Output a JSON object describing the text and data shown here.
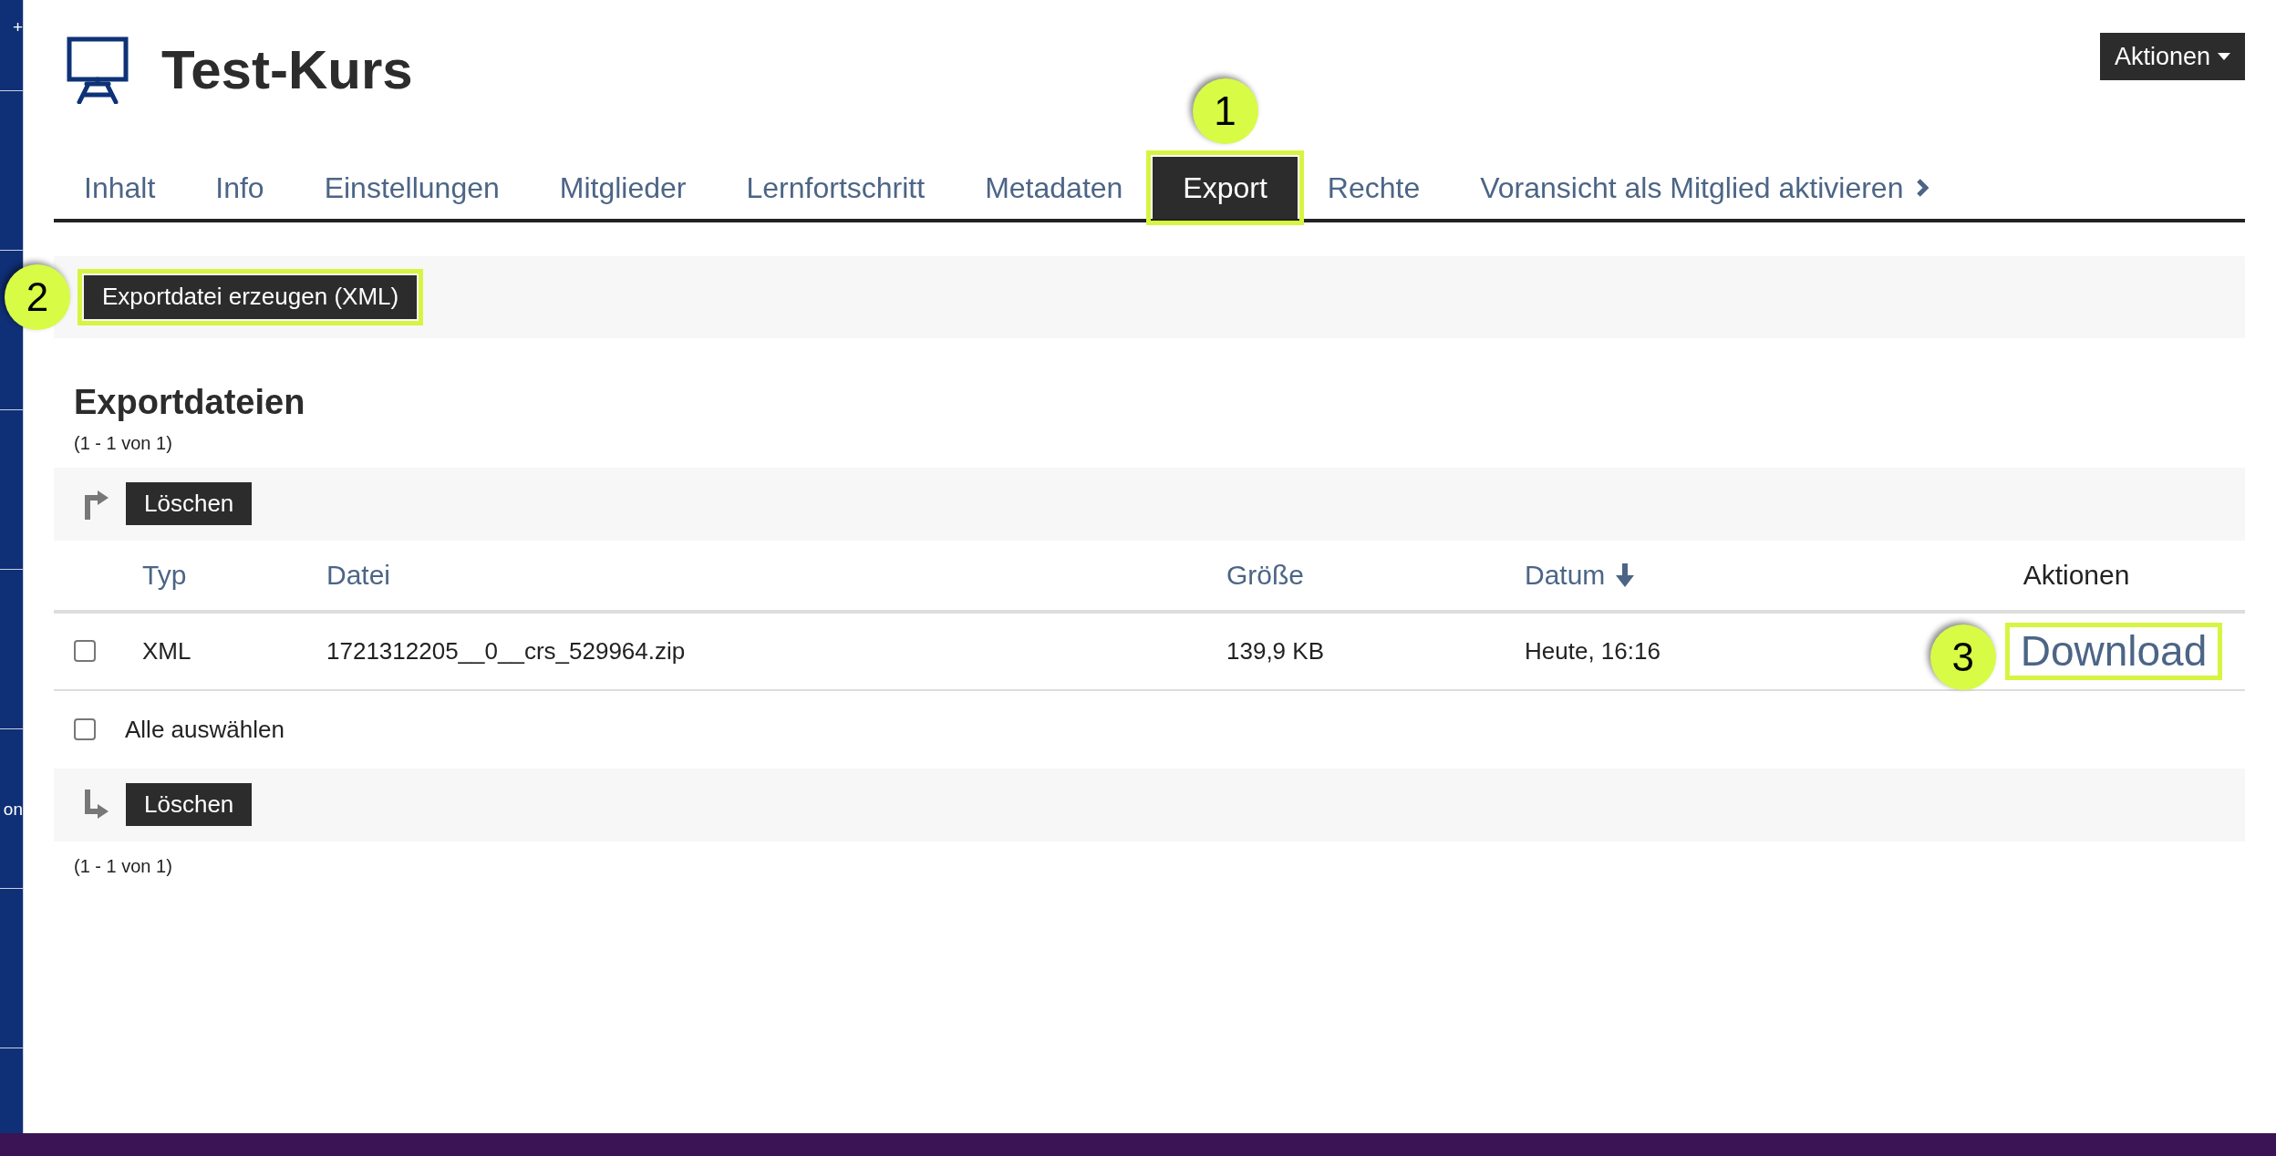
{
  "sidebar": {
    "items": [
      {
        "label": "+"
      },
      {
        "label": "on"
      }
    ]
  },
  "header": {
    "title": "Test-Kurs",
    "actions_button": "Aktionen"
  },
  "tabs": [
    {
      "label": "Inhalt",
      "selected": false,
      "kind": "tab"
    },
    {
      "label": "Info",
      "selected": false,
      "kind": "tab"
    },
    {
      "label": "Einstellungen",
      "selected": false,
      "kind": "tab"
    },
    {
      "label": "Mitglieder",
      "selected": false,
      "kind": "tab"
    },
    {
      "label": "Lernfortschritt",
      "selected": false,
      "kind": "tab"
    },
    {
      "label": "Metadaten",
      "selected": false,
      "kind": "tab"
    },
    {
      "label": "Export",
      "selected": true,
      "kind": "tab",
      "callout": "1"
    },
    {
      "label": "Rechte",
      "selected": false,
      "kind": "tab"
    },
    {
      "label": "Voransicht als Mitglied aktivieren",
      "selected": false,
      "kind": "toggle"
    }
  ],
  "toolbar": {
    "button": "Exportdatei erzeugen (XML)",
    "callout": "2"
  },
  "export_files": {
    "title": "Exportdateien",
    "range_top": "(1 - 1 von 1)",
    "delete_top": "Löschen",
    "table": {
      "columns": [
        {
          "label": "Typ",
          "sortable": true,
          "sorted": false
        },
        {
          "label": "Datei",
          "sortable": true,
          "sorted": false
        },
        {
          "label": "Größe",
          "sortable": true,
          "sorted": false
        },
        {
          "label": "Datum",
          "sortable": true,
          "sorted": true
        },
        {
          "label": "Aktionen",
          "sortable": false
        }
      ],
      "rows": [
        {
          "checked": false,
          "cells": [
            "XML",
            "1721312205__0__crs_529964.zip",
            "139,9 KB",
            "Heute, 16:16"
          ],
          "action": {
            "label": "Download",
            "callout": "3"
          }
        }
      ]
    },
    "select_all": {
      "label": "Alle auswählen",
      "checked": false
    },
    "delete_bottom": "Löschen",
    "range_bottom": "(1 - 1 von 1)"
  }
}
